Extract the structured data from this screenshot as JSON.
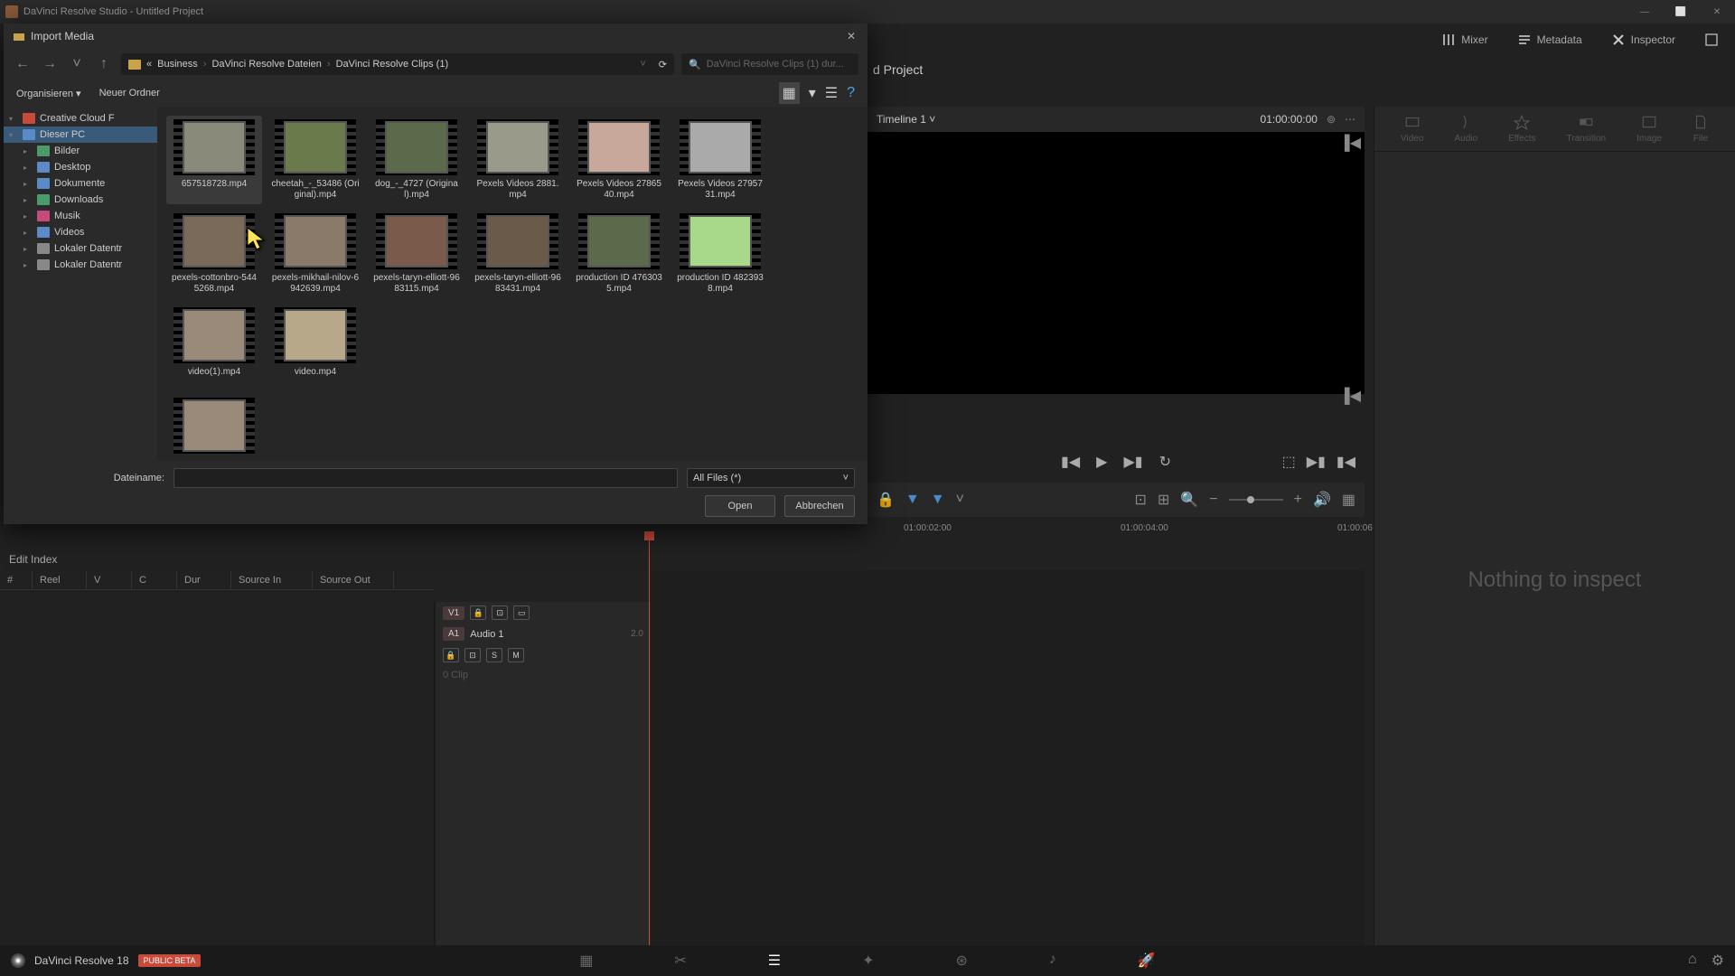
{
  "titlebar": {
    "text": "DaVinci Resolve Studio - Untitled Project"
  },
  "window_controls": {
    "min": "—",
    "max": "⬜",
    "close": "✕"
  },
  "top_toolbar": {
    "mixer": "Mixer",
    "metadata": "Metadata",
    "inspector": "Inspector"
  },
  "project": {
    "title": "d Project"
  },
  "timeline_header": {
    "name": "Timeline 1",
    "timecode": "01:00:00:00"
  },
  "inspector": {
    "tabs": [
      "Video",
      "Audio",
      "Effects",
      "Transition",
      "Image",
      "File"
    ],
    "message": "Nothing to inspect"
  },
  "ruler": {
    "t1": "01:00:02:00",
    "t2": "01:00:04:00",
    "t3": "01:00:06"
  },
  "tracks": {
    "v1": "V1",
    "a1": "A1",
    "a1_name": "Audio 1",
    "a1_ch": "2.0",
    "s": "S",
    "m": "M",
    "clipcount": "0 Clip"
  },
  "edit_index": {
    "title": "Edit Index",
    "cols": {
      "num": "#",
      "reel": "Reel",
      "v": "V",
      "c": "C",
      "dur": "Dur",
      "src_in": "Source In",
      "src_out": "Source Out"
    }
  },
  "bottom": {
    "app": "DaVinci Resolve 18",
    "badge": "PUBLIC BETA"
  },
  "dialog": {
    "title": "Import Media",
    "breadcrumb": {
      "dots": "«",
      "b1": "Business",
      "b2": "DaVinci Resolve Dateien",
      "b3": "DaVinci Resolve Clips (1)"
    },
    "search_placeholder": "DaVinci Resolve Clips (1) dur...",
    "toolbar": {
      "organize": "Organisieren",
      "newfolder": "Neuer Ordner"
    },
    "tree": [
      {
        "label": "Creative Cloud F",
        "color": "#c84a3a",
        "level": 0,
        "expanded": true
      },
      {
        "label": "Dieser PC",
        "color": "#5a8ac8",
        "level": 0,
        "expanded": true,
        "selected": true
      },
      {
        "label": "Bilder",
        "color": "#4a9a6a",
        "level": 1
      },
      {
        "label": "Desktop",
        "color": "#5a8ac8",
        "level": 1
      },
      {
        "label": "Dokumente",
        "color": "#5a8ac8",
        "level": 1
      },
      {
        "label": "Downloads",
        "color": "#4a9a6a",
        "level": 1
      },
      {
        "label": "Musik",
        "color": "#c84a7a",
        "level": 1
      },
      {
        "label": "Videos",
        "color": "#5a8ac8",
        "level": 1
      },
      {
        "label": "Lokaler Datentr",
        "color": "#888",
        "level": 1
      },
      {
        "label": "Lokaler Datentr",
        "color": "#888",
        "level": 1
      }
    ],
    "files": [
      {
        "name": "657518728.mp4",
        "bg": "#8a8a7a",
        "selected": true
      },
      {
        "name": "cheetah_-_53486 (Original).mp4",
        "bg": "#6a7a4a"
      },
      {
        "name": "dog_-_4727 (Original).mp4",
        "bg": "#5a6a4a"
      },
      {
        "name": "Pexels Videos 2881.mp4",
        "bg": "#9a9a8a"
      },
      {
        "name": "Pexels Videos 2786540.mp4",
        "bg": "#c8a89a"
      },
      {
        "name": "Pexels Videos 2795731.mp4",
        "bg": "#aaa"
      },
      {
        "name": "pexels-cottonbro-5445268.mp4",
        "bg": "#7a6a5a"
      },
      {
        "name": "pexels-mikhail-nilov-6942639.mp4",
        "bg": "#8a7a6a"
      },
      {
        "name": "pexels-taryn-elliott-9683115.mp4",
        "bg": "#7a5a4a"
      },
      {
        "name": "pexels-taryn-elliott-9683431.mp4",
        "bg": "#6a5a4a"
      },
      {
        "name": "production ID 4763035.mp4",
        "bg": "#5a6a4a"
      },
      {
        "name": "production ID 4823938.mp4",
        "bg": "#a8d88a"
      },
      {
        "name": "video(1).mp4",
        "bg": "#9a8a7a"
      },
      {
        "name": "video.mp4",
        "bg": "#b8a88a"
      }
    ],
    "extra_file": {
      "bg": "#9a8a7a"
    },
    "footer": {
      "label": "Dateiname:",
      "filter": "All Files (*)",
      "open": "Open",
      "cancel": "Abbrechen"
    }
  }
}
